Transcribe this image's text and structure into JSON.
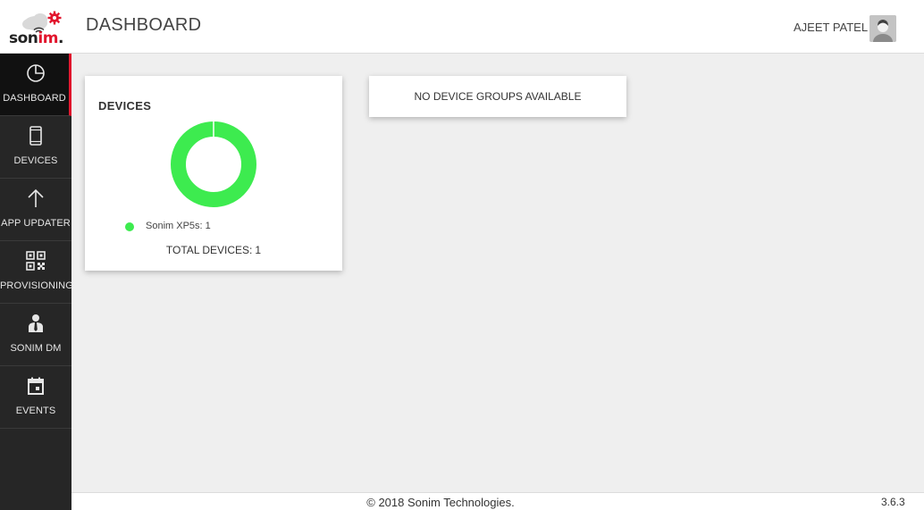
{
  "brand": {
    "name_prefix": "son",
    "name_accent": "im",
    "name_suffix": ".",
    "accent_color": "#e2152d"
  },
  "header": {
    "title": "DASHBOARD",
    "user_name": "AJEET PATEL",
    "avatar_icon": "user-avatar-icon"
  },
  "sidebar": {
    "items": [
      {
        "label": "DASHBOARD",
        "icon": "pie-chart-icon",
        "active": true
      },
      {
        "label": "DEVICES",
        "icon": "smartphone-icon",
        "active": false
      },
      {
        "label": "APP UPDATER",
        "icon": "arrow-up-icon",
        "active": false
      },
      {
        "label": "PROVISIONING",
        "icon": "qr-code-icon",
        "active": false
      },
      {
        "label": "SONIM DM",
        "icon": "person-tie-icon",
        "active": false
      },
      {
        "label": "EVENTS",
        "icon": "calendar-icon",
        "active": false
      }
    ]
  },
  "devices_card": {
    "title": "DEVICES",
    "legend": [
      {
        "label": "Sonim XP5s: 1",
        "color": "#3deb4f"
      }
    ],
    "total_label": "TOTAL DEVICES:",
    "total_value": "1"
  },
  "chart_data": {
    "type": "pie",
    "categories": [
      "Sonim XP5s"
    ],
    "values": [
      1
    ],
    "colors": [
      "#3deb4f"
    ],
    "donut": true,
    "legend_position": "bottom"
  },
  "groups_card": {
    "message": "NO DEVICE GROUPS AVAILABLE"
  },
  "footer": {
    "copyright": "© 2018 Sonim Technologies.",
    "version": "3.6.3"
  }
}
